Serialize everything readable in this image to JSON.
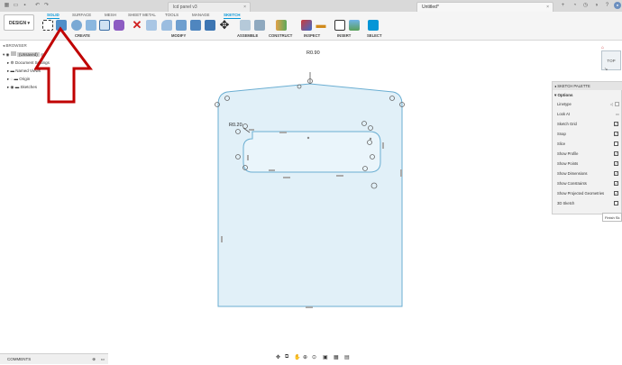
{
  "tabs": {
    "doc_tab": "lcd panel v3",
    "untitled_tab": "Untitled*"
  },
  "toolbar": {
    "design_label": "DESIGN",
    "workspace_tabs": [
      "SOLID",
      "SURFACE",
      "MESH",
      "SHEET METAL",
      "TOOLS",
      "MANAGE",
      "SKETCH"
    ],
    "groups": [
      "CREATE",
      "MODIFY",
      "ASSEMBLE",
      "CONSTRUCT",
      "INSPECT",
      "INSERT",
      "SELECT"
    ]
  },
  "browser": {
    "title": "BROWSER",
    "root": "(Unsaved)",
    "items": [
      "Document Settings",
      "Named Views",
      "Origin",
      "Sketches"
    ]
  },
  "canvas": {
    "dim_top": "R0.90",
    "dim_left": "R0.20",
    "viewcube_label": "TOP"
  },
  "palette": {
    "title": "SKETCH PALETTE",
    "section": "Options",
    "rows": [
      {
        "label": "Linetype",
        "kind": "icons"
      },
      {
        "label": "Look At",
        "kind": "icon"
      },
      {
        "label": "Sketch Grid",
        "checked": true
      },
      {
        "label": "Snap",
        "checked": true
      },
      {
        "label": "Slice",
        "checked": false
      },
      {
        "label": "Show Profile",
        "checked": true
      },
      {
        "label": "Show Points",
        "checked": true
      },
      {
        "label": "Show Dimensions",
        "checked": true
      },
      {
        "label": "Show Constraints",
        "checked": true
      },
      {
        "label": "Show Projected Geometries",
        "checked": true
      },
      {
        "label": "3D Sketch",
        "checked": false
      }
    ],
    "finish_label": "Finish Sk"
  },
  "comments": {
    "label": "COMMENTS"
  },
  "colors": {
    "accent": "#0696d7",
    "sketch_fill": "#e1f0f8",
    "sketch_line": "#6aaed2",
    "arrow_red": "#c00000"
  }
}
